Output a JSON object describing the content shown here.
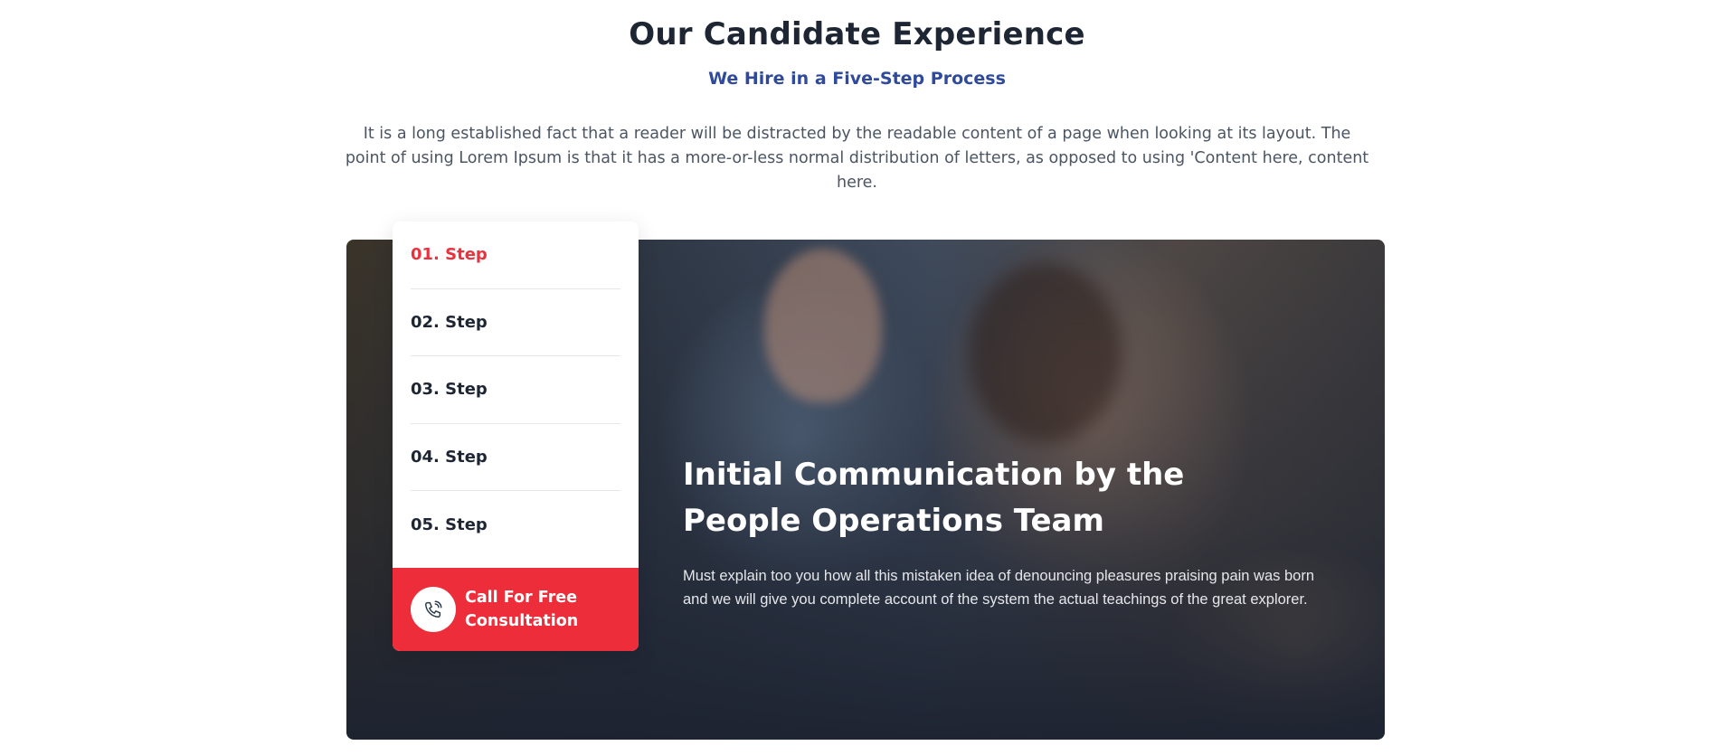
{
  "section": {
    "title": "Our Candidate Experience",
    "subtitle": "We Hire in a Five-Step Process",
    "description": "It is a long established fact that a reader will be distracted by the readable content of a page when looking at its layout. The point of using Lorem Ipsum is that it has a more-or-less normal distribution of letters, as opposed to using 'Content here, content here."
  },
  "steps": {
    "items": [
      {
        "label": "01. Step",
        "active": true
      },
      {
        "label": "02. Step",
        "active": false
      },
      {
        "label": "03. Step",
        "active": false
      },
      {
        "label": "04. Step",
        "active": false
      },
      {
        "label": "05. Step",
        "active": false
      }
    ],
    "call_label": "Call For Free Consultation",
    "call_icon": "phone-icon"
  },
  "hero": {
    "title": "Initial Communication by the People Operations Team",
    "text": "Must explain too you how all this mistaken idea of denouncing pleasures praising pain was born and we will give you complete account of the system the actual teachings of the great explorer."
  },
  "colors": {
    "accent_red": "#ed2d39",
    "active_step": "#e8323e",
    "subtitle_blue": "#2f4a9a",
    "heading_dark": "#1e2533"
  }
}
